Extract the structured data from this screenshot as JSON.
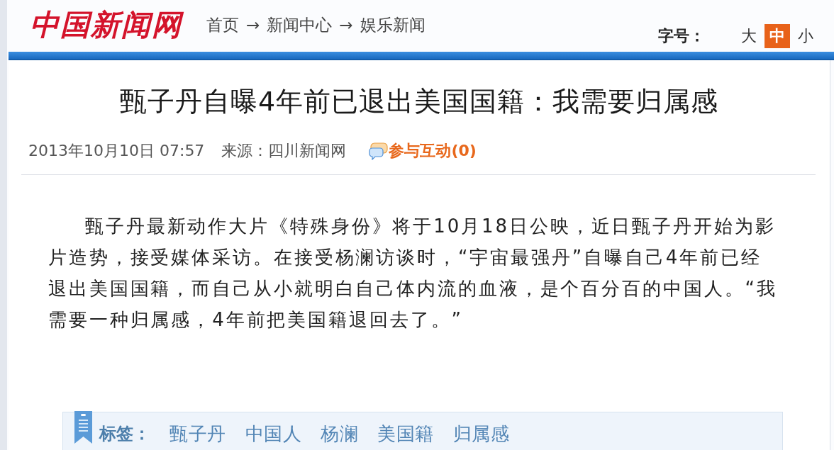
{
  "header": {
    "logo": "中国新闻网",
    "breadcrumb": {
      "items": [
        "首页",
        "新闻中心",
        "娱乐新闻"
      ],
      "separators": [
        "→",
        "→"
      ]
    },
    "font_size": {
      "label": "字号：",
      "options": [
        {
          "label": "大",
          "selected": false
        },
        {
          "label": "中",
          "selected": true
        },
        {
          "label": "小",
          "selected": false
        }
      ]
    }
  },
  "article": {
    "title": "甄子丹自曝4年前已退出美国国籍：我需要归属感",
    "date": "2013年10月10日 07:57",
    "source": "来源：四川新闻网",
    "comments_link": "参与互动(0)",
    "body": "甄子丹最新动作大片《特殊身份》将于10月18日公映，近日甄子丹开始为影片造势，接受媒体采访。在接受杨澜访谈时，“宇宙最强丹”自曝自己4年前已经退出美国国籍，而自己从小就明白自己体内流的血液，是个百分百的中国人。“我需要一种归属感，4年前把美国籍退回去了。”"
  },
  "tags": {
    "label": "标签：",
    "items": [
      "甄子丹",
      "中国人",
      "杨澜",
      "美国籍",
      "归属感"
    ]
  }
}
